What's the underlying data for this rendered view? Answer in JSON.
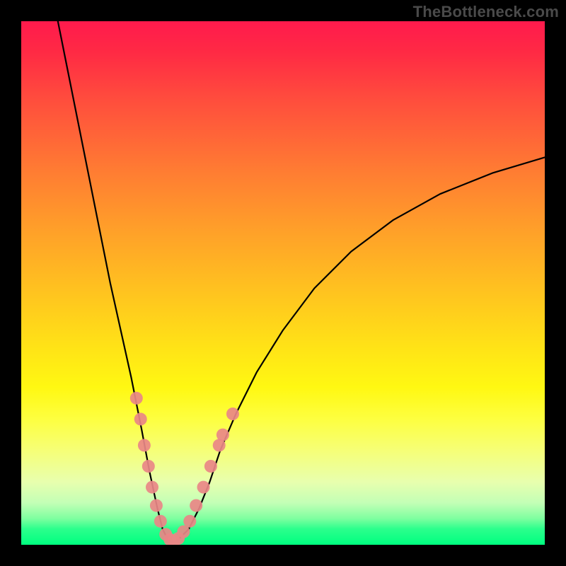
{
  "watermark": "TheBottleneck.com",
  "chart_data": {
    "type": "line",
    "title": "",
    "xlabel": "",
    "ylabel": "",
    "xlim": [
      0,
      100
    ],
    "ylim": [
      0,
      100
    ],
    "grid": false,
    "legend": false,
    "background_gradient": [
      "#ff1a4d",
      "#ff7a33",
      "#ffe516",
      "#fdff40",
      "#00ff80"
    ],
    "series": [
      {
        "name": "bottleneck-curve",
        "color": "#000000",
        "x": [
          7,
          9,
          11,
          13,
          15,
          17,
          19,
          21,
          23,
          24.5,
          26,
          27,
          28,
          29,
          30,
          32,
          34,
          36,
          38,
          41,
          45,
          50,
          56,
          63,
          71,
          80,
          90,
          100
        ],
        "y": [
          100,
          90,
          80,
          70,
          60,
          50,
          41,
          32,
          22,
          14,
          7,
          3,
          1,
          0.5,
          1,
          3,
          7,
          12,
          18,
          25,
          33,
          41,
          49,
          56,
          62,
          67,
          71,
          74
        ]
      }
    ],
    "scatter": {
      "name": "highlight-points",
      "color": "#e98787",
      "radius": 9,
      "points": [
        {
          "x": 22.0,
          "y": 28
        },
        {
          "x": 22.8,
          "y": 24
        },
        {
          "x": 23.5,
          "y": 19
        },
        {
          "x": 24.3,
          "y": 15
        },
        {
          "x": 25.0,
          "y": 11
        },
        {
          "x": 25.8,
          "y": 7.5
        },
        {
          "x": 26.6,
          "y": 4.5
        },
        {
          "x": 27.6,
          "y": 2.0
        },
        {
          "x": 28.4,
          "y": 1.0
        },
        {
          "x": 29.2,
          "y": 0.8
        },
        {
          "x": 30.0,
          "y": 1.2
        },
        {
          "x": 31.0,
          "y": 2.5
        },
        {
          "x": 32.2,
          "y": 4.5
        },
        {
          "x": 33.4,
          "y": 7.5
        },
        {
          "x": 34.8,
          "y": 11
        },
        {
          "x": 36.2,
          "y": 15
        },
        {
          "x": 37.8,
          "y": 19
        },
        {
          "x": 38.5,
          "y": 21
        },
        {
          "x": 40.4,
          "y": 25
        }
      ]
    }
  }
}
